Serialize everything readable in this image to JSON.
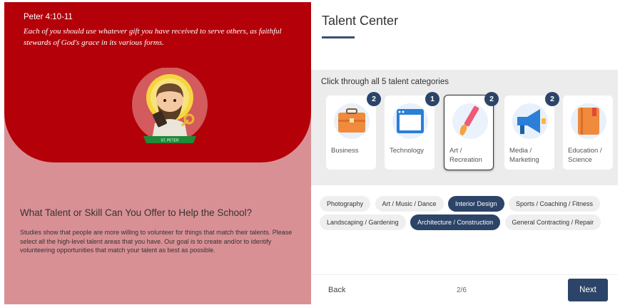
{
  "verse": {
    "reference": "Peter 4:10-11",
    "text": "Each of you should use whatever gift you have received to serve others, as faithful stewards of God's grace in its various forms.",
    "banner_text": "ST. PETER"
  },
  "intro": {
    "heading": "What Talent or Skill Can You Offer to Help the School?",
    "body": "Studies show that people are more willing to volunteer for things that match their talents. Please select all the high-level talent areas that you have. Our goal is to create and/or to identify volunteering opportunities that match your talent as best as possible."
  },
  "talent_center": {
    "title": "Talent Center",
    "categories_heading": "Click through all 5 talent categories",
    "categories": [
      {
        "label": "Business",
        "badge": "2",
        "icon": "briefcase-icon"
      },
      {
        "label": "Technology",
        "badge": "1",
        "icon": "browser-window-icon"
      },
      {
        "label": "Art / Recreation",
        "badge": "2",
        "icon": "paintbrush-icon"
      },
      {
        "label": "Media / Marketing",
        "badge": "2",
        "icon": "megaphone-icon"
      },
      {
        "label": "Education / Science",
        "badge": "",
        "icon": "book-icon"
      }
    ],
    "subcategories": [
      {
        "label": "Photography",
        "selected": false
      },
      {
        "label": "Art / Music / Dance",
        "selected": false
      },
      {
        "label": "Interior Design",
        "selected": true
      },
      {
        "label": "Sports / Coaching / Fitness",
        "selected": false
      },
      {
        "label": "Landscaping / Gardening",
        "selected": false
      },
      {
        "label": "Architecture / Construction",
        "selected": true
      },
      {
        "label": "General Contracting / Repair",
        "selected": false
      }
    ],
    "footer": {
      "back_label": "Back",
      "page_indicator": "2/6",
      "next_label": "Next"
    }
  },
  "colors": {
    "accent": "#2c4467",
    "hero_red": "#b30009",
    "panel_pink": "#d99095"
  }
}
